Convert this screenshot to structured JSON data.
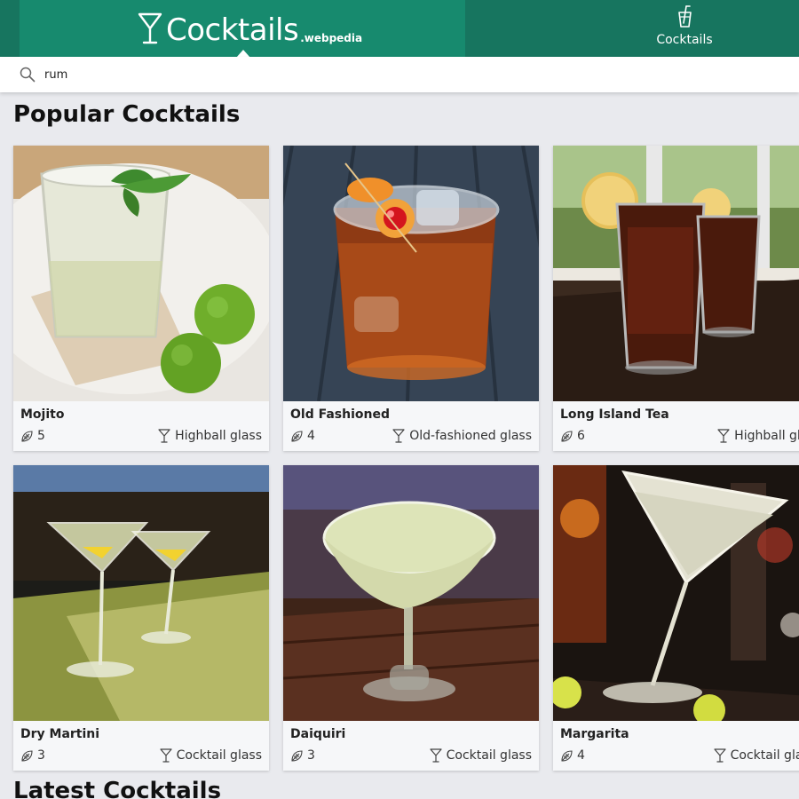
{
  "header": {
    "brand": "Cocktails",
    "brand_suffix": ".webpedia",
    "nav_label": "Cocktails"
  },
  "search": {
    "value": "rum"
  },
  "popular": {
    "title": "Popular Cocktails",
    "cards": [
      {
        "name": "Mojito",
        "ingredients": "5",
        "glass": "Highball glass"
      },
      {
        "name": "Old Fashioned",
        "ingredients": "4",
        "glass": "Old-fashioned glass"
      },
      {
        "name": "Long Island Tea",
        "ingredients": "6",
        "glass": "Highball glass"
      },
      {
        "name": "Dry Martini",
        "ingredients": "3",
        "glass": "Cocktail glass"
      },
      {
        "name": "Daiquiri",
        "ingredients": "3",
        "glass": "Cocktail glass"
      },
      {
        "name": "Margarita",
        "ingredients": "4",
        "glass": "Cocktail glass"
      }
    ]
  },
  "latest": {
    "title": "Latest Cocktails"
  },
  "colors": {
    "header_dark": "#17755f",
    "header_active": "#178a6e",
    "background": "#e9eaee",
    "card": "#f6f7f9"
  },
  "icons": [
    "martini-glass-logo-icon",
    "drink-cup-icon",
    "search-icon",
    "leaf-icon",
    "cocktail-glass-icon"
  ]
}
